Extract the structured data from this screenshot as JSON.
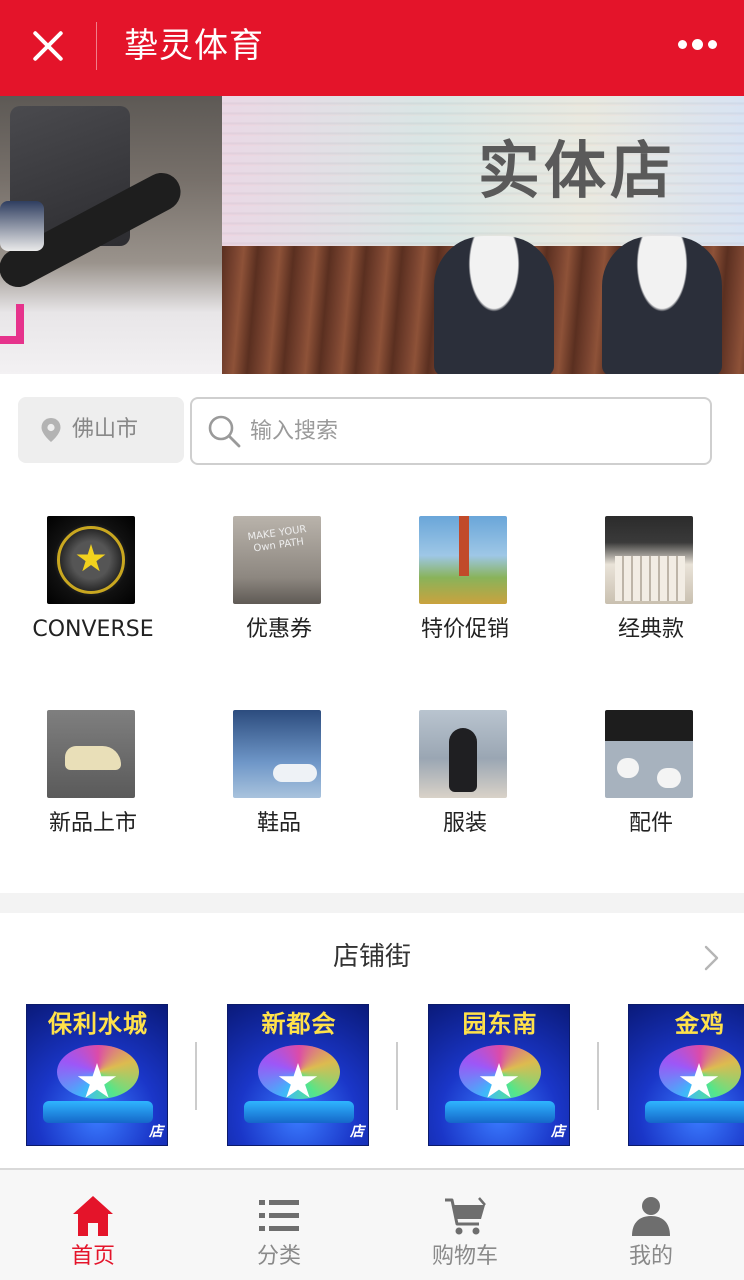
{
  "app": {
    "title": "挚灵体育"
  },
  "banner": {
    "text": "实体店",
    "accent_color": "#e6338c"
  },
  "search": {
    "city": "佛山市",
    "placeholder": "输入搜索"
  },
  "categories": [
    {
      "label": "CONVERSE",
      "icon": "one-star-logo"
    },
    {
      "label": "优惠券",
      "icon": "sneakers-photo"
    },
    {
      "label": "特价促销",
      "icon": "sneaker-sky-photo"
    },
    {
      "label": "经典款",
      "icon": "radiator-sneaker-photo"
    },
    {
      "label": "新品上市",
      "icon": "sneaker-step-photo"
    },
    {
      "label": "鞋品",
      "icon": "sneaker-blue-photo"
    },
    {
      "label": "服装",
      "icon": "apparel-photo"
    },
    {
      "label": "配件",
      "icon": "accessory-photo"
    }
  ],
  "store_street": {
    "title": "店铺街",
    "stores": [
      {
        "name": "保利水城",
        "tag": "店"
      },
      {
        "name": "新都会",
        "tag": "店"
      },
      {
        "name": "园东南",
        "tag": "店"
      },
      {
        "name": "金鸡",
        "tag": "店"
      }
    ]
  },
  "tabbar": {
    "items": [
      {
        "label": "首页",
        "icon": "home-icon",
        "active": true
      },
      {
        "label": "分类",
        "icon": "list-icon",
        "active": false
      },
      {
        "label": "购物车",
        "icon": "cart-icon",
        "active": false
      },
      {
        "label": "我的",
        "icon": "user-icon",
        "active": false
      }
    ]
  },
  "colors": {
    "brand": "#e4142a",
    "inactive": "#8a8a8a"
  }
}
